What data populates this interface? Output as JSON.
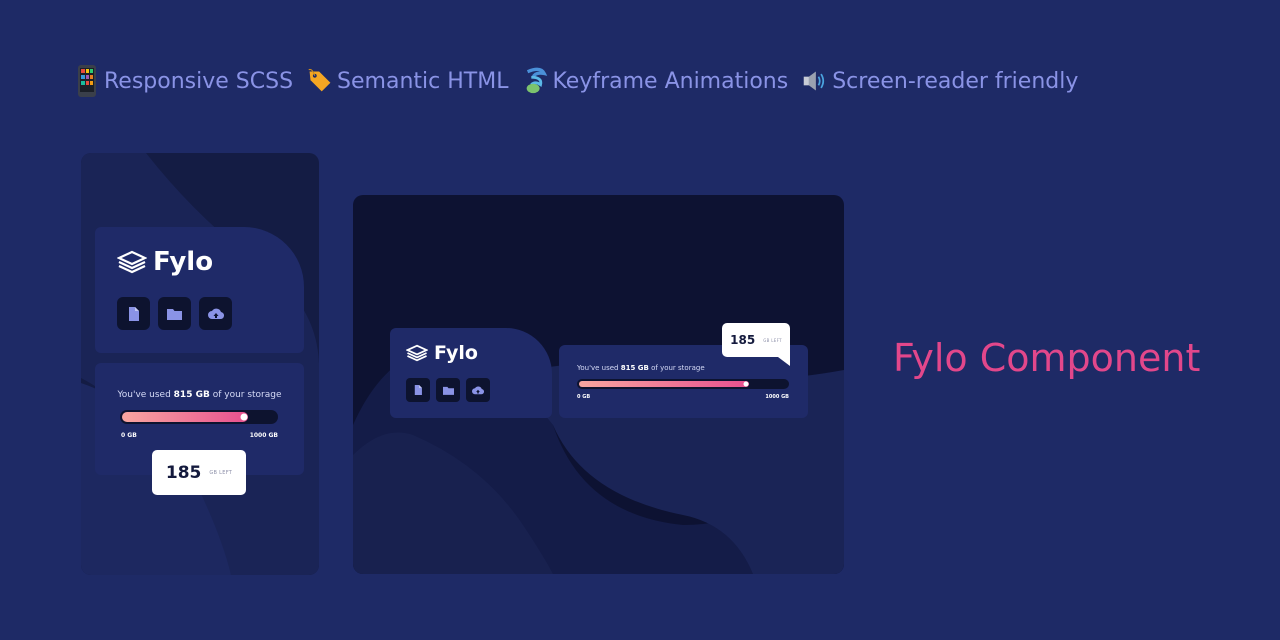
{
  "features": [
    {
      "icon": "phone-icon",
      "label": "Responsive SCSS"
    },
    {
      "icon": "tag-icon",
      "label": "Semantic HTML"
    },
    {
      "icon": "cyclone-icon",
      "label": "Keyframe Animations"
    },
    {
      "icon": "speaker-icon",
      "label": "Screen-reader friendly"
    }
  ],
  "brand": {
    "name": "Fylo"
  },
  "storage": {
    "used_prefix": "You've used ",
    "used_amount": "815 GB",
    "used_suffix": " of your storage",
    "min_label": "0 GB",
    "max_label": "1000 GB",
    "remaining_value": "185",
    "remaining_label": "GB LEFT",
    "used_fraction": 0.815
  },
  "buttons": [
    "document-icon",
    "folder-icon",
    "upload-icon"
  ],
  "component_title": "Fylo Component",
  "colors": {
    "background": "#1e2a66",
    "accent_pink": "#e2478b",
    "feature_text": "#8a93e6",
    "card": "#1f2a68"
  }
}
